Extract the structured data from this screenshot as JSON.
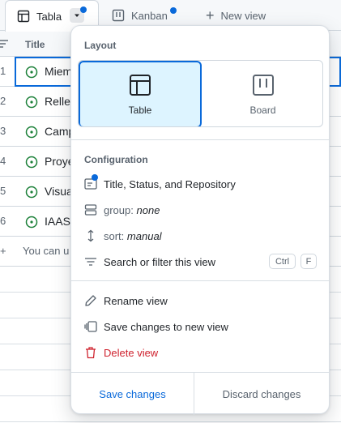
{
  "tabs": [
    {
      "label": "Tabla",
      "icon": "table-icon",
      "active": true,
      "has_indicator": true
    },
    {
      "label": "Kanban",
      "icon": "board-icon",
      "active": false,
      "has_indicator": true
    },
    {
      "label": "New view",
      "icon": "plus-icon",
      "active": false
    }
  ],
  "grid": {
    "column_title": "Title",
    "rows": [
      {
        "num": "1",
        "title": "Miem",
        "status": "open"
      },
      {
        "num": "2",
        "title": "Relle",
        "status": "open"
      },
      {
        "num": "3",
        "title": "Camp",
        "status": "open"
      },
      {
        "num": "4",
        "title": "Proye",
        "status": "open"
      },
      {
        "num": "5",
        "title": "Visua",
        "status": "open"
      },
      {
        "num": "6",
        "title": "IAAS.",
        "status": "open"
      }
    ],
    "add_row": {
      "num": "+",
      "text": "You can u"
    }
  },
  "popup": {
    "layout_title": "Layout",
    "layout_options": [
      {
        "label": "Table",
        "icon": "table-layout-icon",
        "selected": true
      },
      {
        "label": "Board",
        "icon": "board-layout-icon",
        "selected": false
      }
    ],
    "configuration_title": "Configuration",
    "fields_label": "Title, Status, and Repository",
    "group_prefix": "group:",
    "group_value": "none",
    "sort_prefix": "sort:",
    "sort_value": "manual",
    "filter_label": "Search or filter this view",
    "shortcut_keys": [
      "Ctrl",
      "F"
    ],
    "rename_label": "Rename view",
    "save_new_label": "Save changes to new view",
    "delete_label": "Delete view",
    "save_button": "Save changes",
    "discard_button": "Discard changes"
  },
  "colors": {
    "accent": "#0969da",
    "danger": "#cf222e",
    "status_open": "#1a7f37",
    "selected_bg": "#ddf4ff"
  }
}
